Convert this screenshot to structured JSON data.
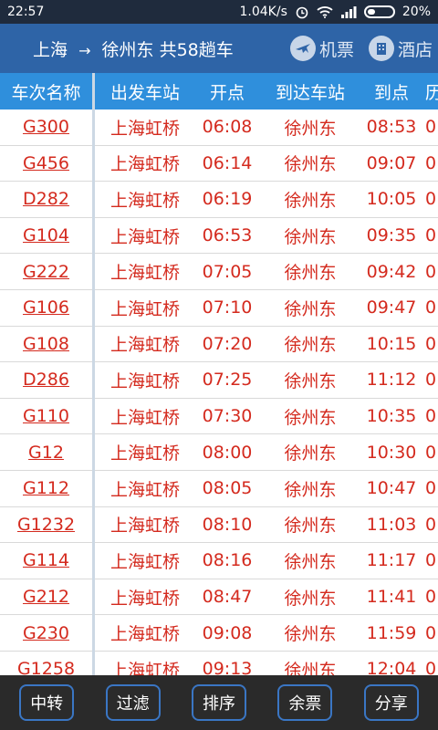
{
  "status_bar": {
    "time": "22:57",
    "network_speed": "1.04K/s",
    "battery_percent": "20%",
    "icons": [
      "alarm-icon",
      "wifi-icon",
      "signal-icon",
      "battery-icon"
    ]
  },
  "header": {
    "from_station": "上海",
    "arrow": "→",
    "to_station": "徐州东",
    "count_text": "共58趟车",
    "flight_label": "机票",
    "hotel_label": "酒店",
    "colors": {
      "bar": "#2e64a7"
    }
  },
  "table": {
    "columns": [
      "车次名称",
      "出发车站",
      "开点",
      "到达车站",
      "到点",
      "历"
    ],
    "rows": [
      {
        "train": "G300",
        "from": "上海虹桥",
        "depart": "06:08",
        "to": "徐州东",
        "arrive": "08:53",
        "extra": "0"
      },
      {
        "train": "G456",
        "from": "上海虹桥",
        "depart": "06:14",
        "to": "徐州东",
        "arrive": "09:07",
        "extra": "0"
      },
      {
        "train": "D282",
        "from": "上海虹桥",
        "depart": "06:19",
        "to": "徐州东",
        "arrive": "10:05",
        "extra": "0"
      },
      {
        "train": "G104",
        "from": "上海虹桥",
        "depart": "06:53",
        "to": "徐州东",
        "arrive": "09:35",
        "extra": "0"
      },
      {
        "train": "G222",
        "from": "上海虹桥",
        "depart": "07:05",
        "to": "徐州东",
        "arrive": "09:42",
        "extra": "0"
      },
      {
        "train": "G106",
        "from": "上海虹桥",
        "depart": "07:10",
        "to": "徐州东",
        "arrive": "09:47",
        "extra": "0"
      },
      {
        "train": "G108",
        "from": "上海虹桥",
        "depart": "07:20",
        "to": "徐州东",
        "arrive": "10:15",
        "extra": "0"
      },
      {
        "train": "D286",
        "from": "上海虹桥",
        "depart": "07:25",
        "to": "徐州东",
        "arrive": "11:12",
        "extra": "0"
      },
      {
        "train": "G110",
        "from": "上海虹桥",
        "depart": "07:30",
        "to": "徐州东",
        "arrive": "10:35",
        "extra": "0"
      },
      {
        "train": "G12",
        "from": "上海虹桥",
        "depart": "08:00",
        "to": "徐州东",
        "arrive": "10:30",
        "extra": "0"
      },
      {
        "train": "G112",
        "from": "上海虹桥",
        "depart": "08:05",
        "to": "徐州东",
        "arrive": "10:47",
        "extra": "0"
      },
      {
        "train": "G1232",
        "from": "上海虹桥",
        "depart": "08:10",
        "to": "徐州东",
        "arrive": "11:03",
        "extra": "0"
      },
      {
        "train": "G114",
        "from": "上海虹桥",
        "depart": "08:16",
        "to": "徐州东",
        "arrive": "11:17",
        "extra": "0"
      },
      {
        "train": "G212",
        "from": "上海虹桥",
        "depart": "08:47",
        "to": "徐州东",
        "arrive": "11:41",
        "extra": "0"
      },
      {
        "train": "G230",
        "from": "上海虹桥",
        "depart": "09:08",
        "to": "徐州东",
        "arrive": "11:59",
        "extra": "0"
      },
      {
        "train": "G1258",
        "from": "上海虹桥",
        "depart": "09:13",
        "to": "徐州东",
        "arrive": "12:04",
        "extra": "0"
      }
    ],
    "colors": {
      "header_bg": "#2f8fdc",
      "row_text": "#d42a1e"
    }
  },
  "toolbar": {
    "buttons": [
      "中转",
      "过滤",
      "排序",
      "余票",
      "分享"
    ],
    "colors": {
      "border": "#3a76c4",
      "bg": "#2a2a2a"
    }
  }
}
